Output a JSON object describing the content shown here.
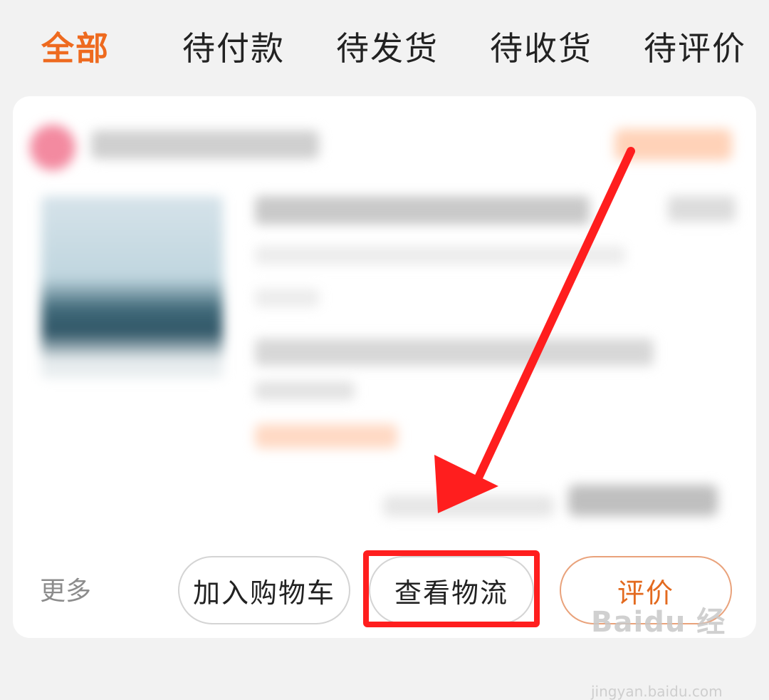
{
  "tabs": [
    {
      "label": "全部",
      "active": true
    },
    {
      "label": "待付款",
      "active": false
    },
    {
      "label": "待发货",
      "active": false
    },
    {
      "label": "待收货",
      "active": false
    },
    {
      "label": "待评价",
      "active": false
    }
  ],
  "order_card": {
    "more_label": "更多",
    "buttons": {
      "add_to_cart": "加入购物车",
      "view_logistics": "查看物流",
      "review": "评价"
    }
  },
  "watermark": {
    "logo_text": "Baidu 经验",
    "url": "jingyan.baidu.com"
  },
  "colors": {
    "accent": "#ee6a1f",
    "annotation_red": "#ff1e1e"
  }
}
